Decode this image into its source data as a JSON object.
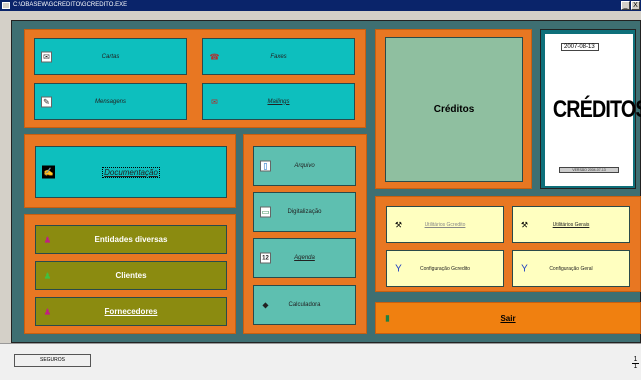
{
  "window": {
    "title": "C:\\OBASEW\\GCREDITO\\GCREDITO.EXE",
    "min_label": "_",
    "close_label": "X"
  },
  "menu": {
    "cartas": "Cartas",
    "faxes": "Faxes",
    "mensagens": "Mensagens",
    "mailings": "Mailings",
    "documentacao": "Documentação",
    "entidades": "Entidades diversas",
    "clientes": "Clientes",
    "fornecedores": "Fornecedores",
    "arquivo": "Arquivo",
    "digitalizacao": "Digitalização",
    "agenda": "Agenda",
    "calculadora": "Calculadora",
    "creditos": "Créditos",
    "utilitarios_gcredito": "Utilitários Gcredito",
    "utilitarios_gerais": "Utilitários Gerais",
    "config_gcredito": "Configuração Gcredito",
    "config_geral": "Configuração Geral",
    "sair": "Sair"
  },
  "card": {
    "date": "2007-08-13",
    "title": "CRÉDITOS",
    "version": "VERSÃO 2004-07-13"
  },
  "status": {
    "tab_label": "SEGUROS",
    "page_num": "1",
    "page_den": "1"
  },
  "colors": {
    "background": "#3e6f72",
    "panel": "#e87722",
    "teal_button": "#0dbfbe",
    "olive_button": "#8b8b10",
    "yellow_button": "#ffffc0",
    "titlebar": "#0a246a"
  },
  "icons": {
    "cartas": "letter-icon",
    "faxes": "fax-icon",
    "mensagens": "message-icon",
    "mailings": "mailing-icon",
    "documentacao": "document-icon",
    "entidades": "people-icon",
    "clientes": "client-icon",
    "fornecedores": "supplier-icon",
    "arquivo": "file-icon",
    "digitalizacao": "scanner-icon",
    "agenda": "calendar-icon",
    "calculadora": "calculator-icon",
    "utilitarios": "tool-icon",
    "configuracao": "wrench-icon",
    "sair": "exit-icon"
  }
}
